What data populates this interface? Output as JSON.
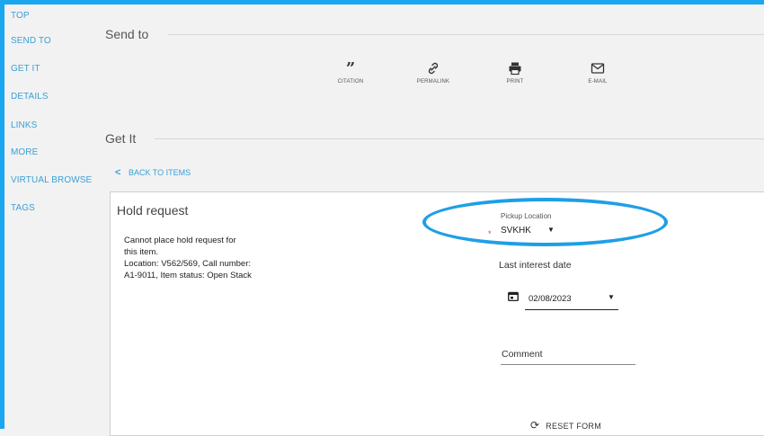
{
  "sidebar": {
    "items": [
      {
        "label": "TOP"
      },
      {
        "label": "SEND TO"
      },
      {
        "label": "GET IT"
      },
      {
        "label": "DETAILS"
      },
      {
        "label": "LINKS"
      },
      {
        "label": "MORE"
      },
      {
        "label": "VIRTUAL BROWSE"
      },
      {
        "label": "TAGS"
      }
    ]
  },
  "send_to": {
    "title": "Send to",
    "actions": [
      {
        "label": "CITATION",
        "icon": "quote-icon"
      },
      {
        "label": "PERMALINK",
        "icon": "link-icon"
      },
      {
        "label": "PRINT",
        "icon": "printer-icon"
      },
      {
        "label": "E-MAIL",
        "icon": "mail-icon"
      }
    ]
  },
  "get_it": {
    "title": "Get It",
    "back_label": "BACK TO ITEMS"
  },
  "hold_request": {
    "title": "Hold request",
    "message_lines": [
      "Cannot place hold request for",
      "this item.",
      "Location: V562/569,  Call number:",
      "A1-9011,  Item status: Open Stack"
    ],
    "pickup_label": "Pickup Location",
    "pickup_required_mark": "*",
    "pickup_value": "SVKHK",
    "last_interest_label": "Last interest date",
    "last_interest_value": "02/08/2023",
    "comment_label": "Comment",
    "reset_label": "RESET FORM"
  },
  "colors": {
    "accent": "#1aa7f0",
    "link": "#3aa0d8",
    "highlight": "#1e9fe6",
    "required": "#e53935"
  }
}
